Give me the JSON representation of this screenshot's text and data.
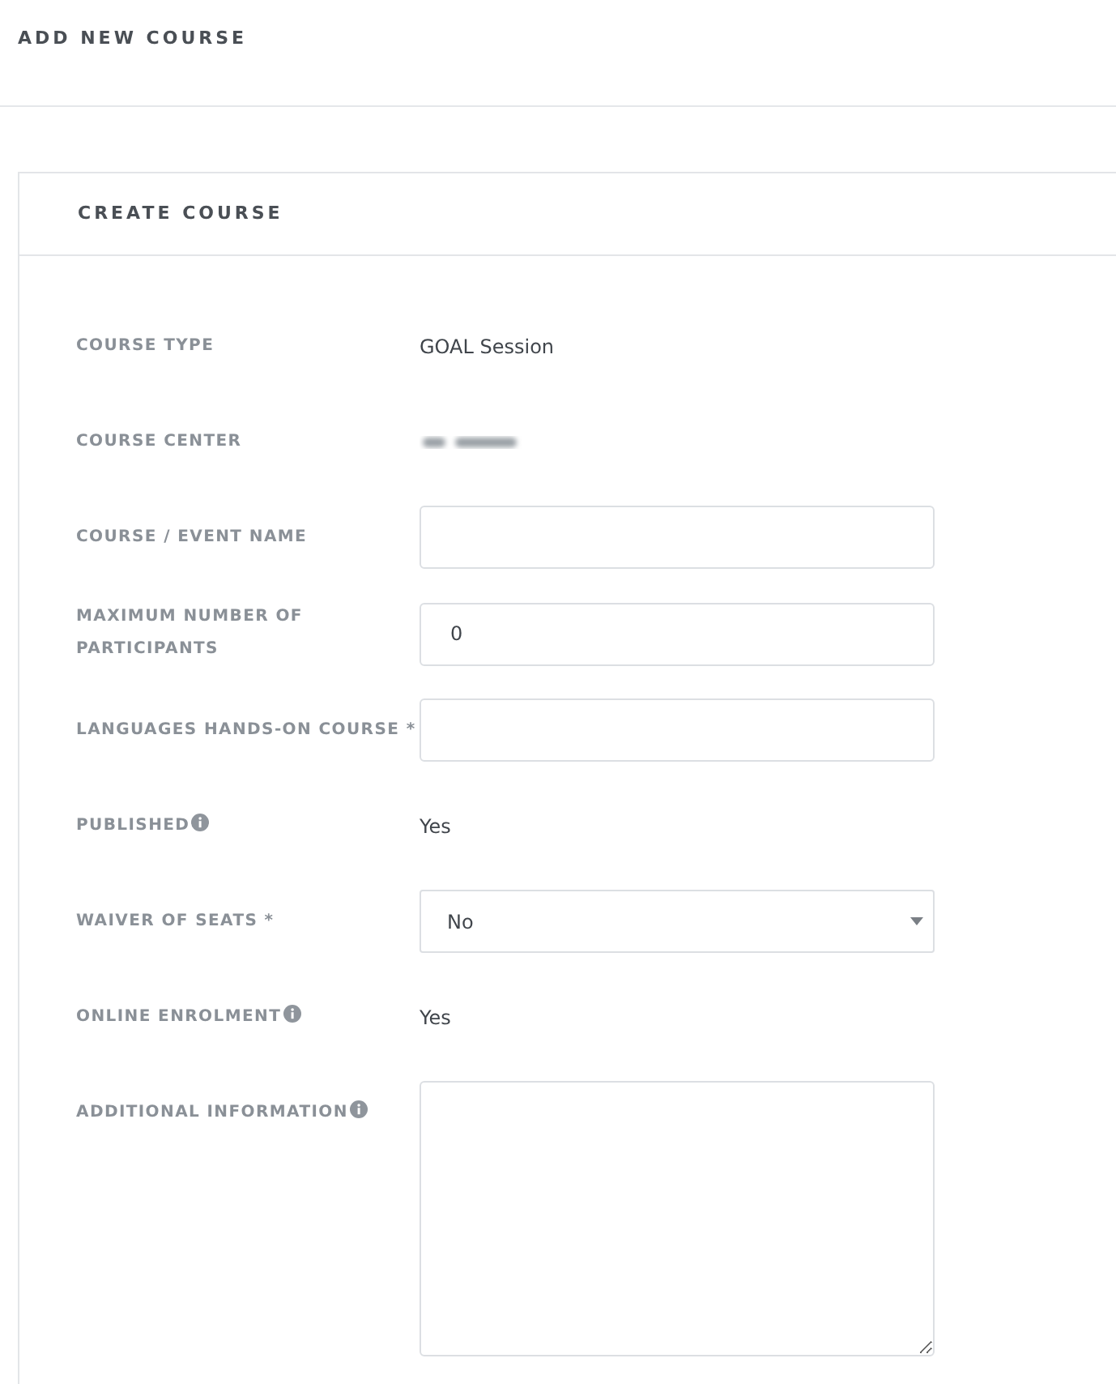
{
  "page_title": "ADD NEW COURSE",
  "card": {
    "title": "CREATE COURSE",
    "fields": [
      {
        "label": "COURSE TYPE",
        "info": false,
        "kind": "text",
        "value": "GOAL Session"
      },
      {
        "label": "COURSE CENTER",
        "info": false,
        "kind": "redacted"
      },
      {
        "label": "COURSE / EVENT NAME",
        "info": false,
        "kind": "input"
      },
      {
        "label": "MAXIMUM NUMBER OF PARTICIPANTS",
        "info": false,
        "kind": "input",
        "value": "0"
      },
      {
        "label": "LANGUAGES HANDS-ON COURSE *",
        "info": false,
        "kind": "input"
      },
      {
        "label": "PUBLISHED",
        "info": true,
        "kind": "text",
        "value": "Yes"
      },
      {
        "label": "WAIVER OF SEATS *",
        "info": false,
        "kind": "select",
        "value": "No"
      },
      {
        "label": "ONLINE ENROLMENT",
        "info": true,
        "kind": "text",
        "value": "Yes"
      },
      {
        "label": "ADDITIONAL INFORMATION",
        "info": true,
        "kind": "textarea"
      }
    ]
  }
}
